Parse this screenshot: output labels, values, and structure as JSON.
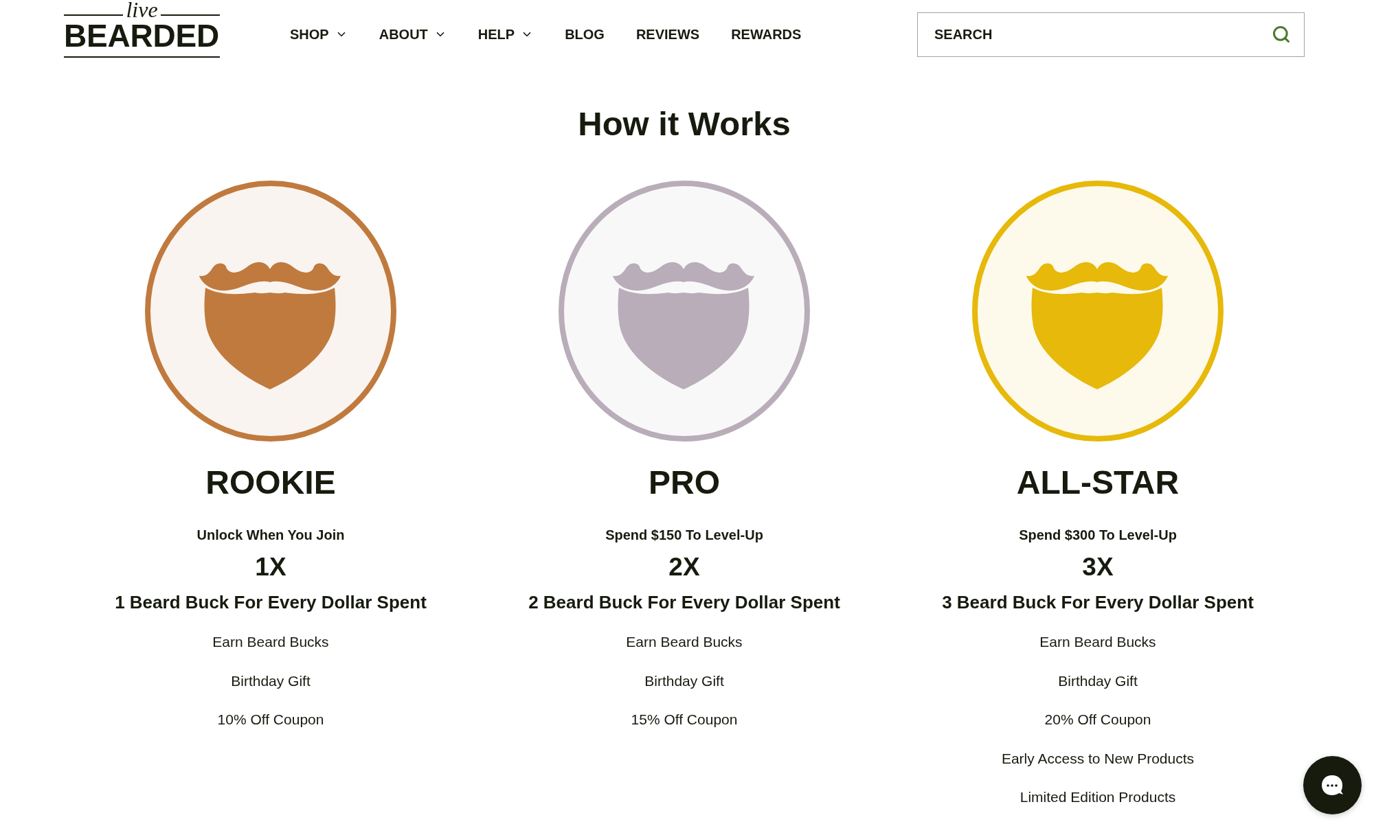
{
  "header": {
    "logo": {
      "script": "live",
      "wordmark": "BEARDED"
    },
    "nav": [
      {
        "label": "SHOP",
        "dropdown": true
      },
      {
        "label": "ABOUT",
        "dropdown": true
      },
      {
        "label": "HELP",
        "dropdown": true
      },
      {
        "label": "BLOG",
        "dropdown": false
      },
      {
        "label": "REVIEWS",
        "dropdown": false
      },
      {
        "label": "REWARDS",
        "dropdown": false
      }
    ],
    "search": {
      "placeholder": "SEARCH"
    }
  },
  "title": "How it Works",
  "tiers": [
    {
      "name": "ROOKIE",
      "color": "#c07a3e",
      "requirement": "Unlock When You Join",
      "multiplier": "1X",
      "earn_rate": "1 Beard Buck For Every Dollar Spent",
      "perks": [
        "Earn Beard Bucks",
        "Birthday Gift",
        "10% Off Coupon"
      ]
    },
    {
      "name": "PRO",
      "color": "#b8adb8",
      "requirement": "Spend $150 To Level-Up",
      "multiplier": "2X",
      "earn_rate": "2 Beard Buck For Every Dollar Spent",
      "perks": [
        "Earn Beard Bucks",
        "Birthday Gift",
        "15% Off Coupon"
      ]
    },
    {
      "name": "ALL-STAR",
      "color": "#e6b90a",
      "requirement": "Spend $300 To Level-Up",
      "multiplier": "3X",
      "earn_rate": "3 Beard Buck For Every Dollar Spent",
      "perks": [
        "Earn Beard Bucks",
        "Birthday Gift",
        "20% Off Coupon",
        "Early Access to New Products",
        "Limited Edition Products"
      ]
    }
  ]
}
